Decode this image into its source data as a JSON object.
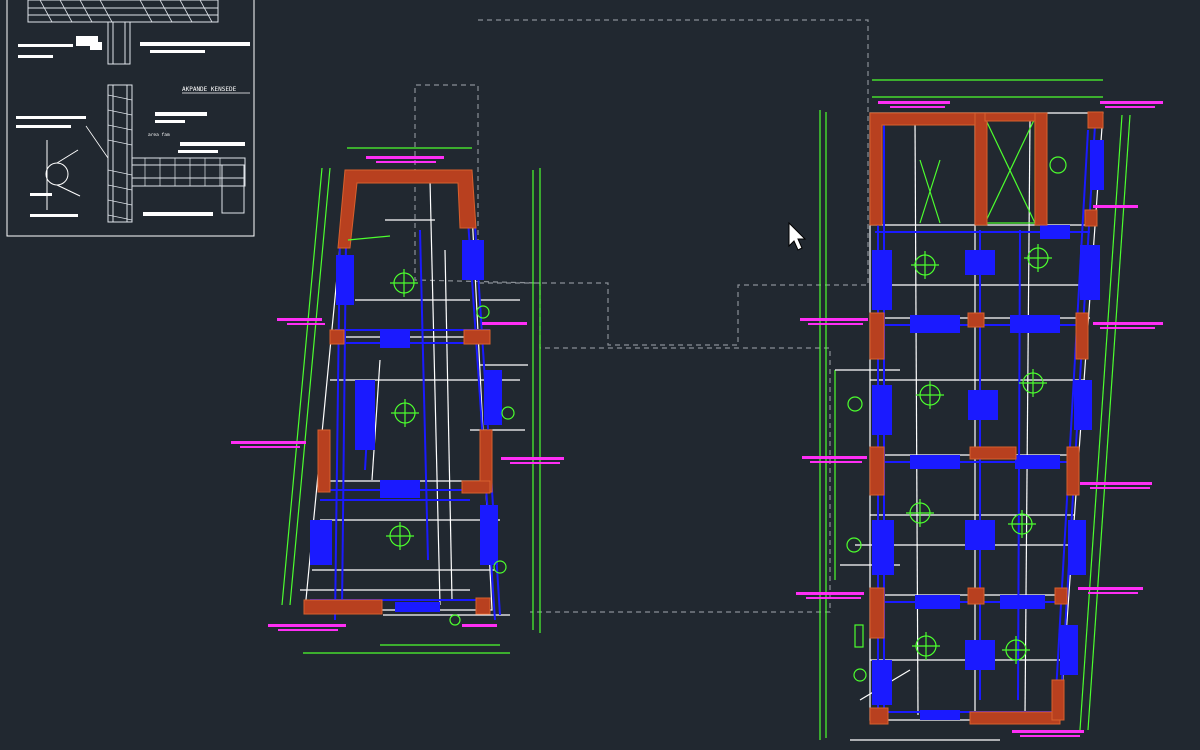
{
  "app": {
    "background": "#212830"
  },
  "colors": {
    "rebar": "#1a1aff",
    "dimension": "#4cff2e",
    "annotation": "#ff2ef5",
    "outline": "#ffffff",
    "column_fill": "#b8401f",
    "column_hatch": "#d9602d",
    "reference_outline": "#8a8f96"
  },
  "detail_sheet": {
    "section_label": "AKPANDE KENSEDE",
    "note_label": "area fam"
  },
  "cursor": {
    "icon": "arrow-cursor-icon"
  }
}
